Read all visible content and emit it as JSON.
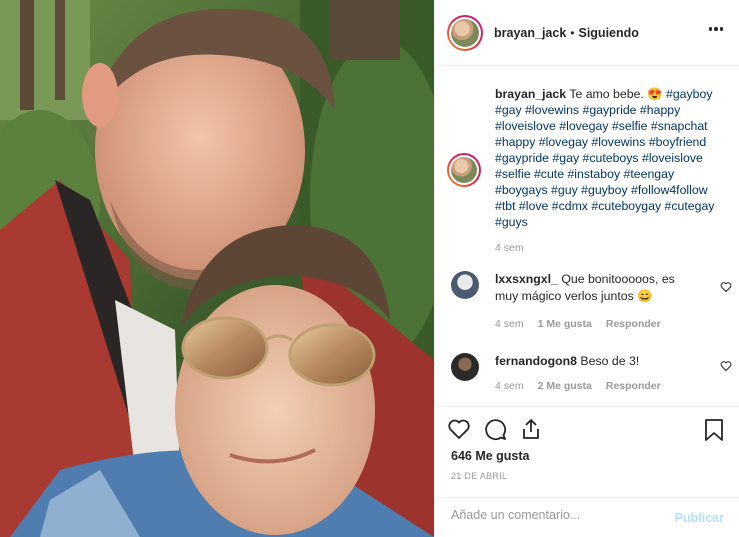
{
  "post": {
    "username": "brayan_jack",
    "separator": "•",
    "follow_status": "Siguiendo",
    "more_icon": "more-horizontal-icon"
  },
  "caption": {
    "username": "brayan_jack",
    "text": "Te amo bebe. 😍",
    "hashtags": "#gayboy #gay #lovewins #gaypride #happy #loveislove #lovegay #selfie #snapchat #happy #lovegay #lovewins #boyfriend #gaypride #gay #cuteboys #loveislove #selfie #cute #instaboy #teengay #boygays #guy #guyboy #follow4follow #tbt #love #cdmx #cuteboygay #cutegay #guys",
    "time": "4 sem"
  },
  "comments": [
    {
      "username": "lxxsxngxl_",
      "text": "Que bonitooooos, es muy mágico verlos juntos 😄",
      "time": "4 sem",
      "likes": "1 Me gusta",
      "reply": "Responder"
    },
    {
      "username": "fernandogon8",
      "text": "Beso de 3!",
      "time": "4 sem",
      "likes": "2 Me gusta",
      "reply": "Responder"
    }
  ],
  "actions": {
    "like_icon": "heart-icon",
    "comment_icon": "comment-icon",
    "share_icon": "share-icon",
    "save_icon": "bookmark-icon"
  },
  "likes_count": "646 Me gusta",
  "date": "21 DE ABRIL",
  "add_comment": {
    "placeholder": "Añade un comentario...",
    "publish_label": "Publicar"
  },
  "colors": {
    "link": "#003569",
    "publish_disabled": "#b2dffc",
    "secondary_text": "#999999"
  }
}
